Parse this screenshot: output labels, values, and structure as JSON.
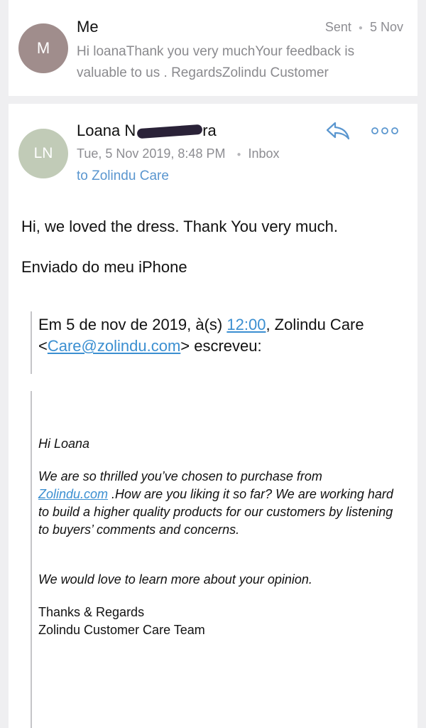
{
  "top_message": {
    "avatar_initial": "M",
    "sender": "Me",
    "status": "Sent",
    "date": "5 Nov",
    "preview": "Hi loanaThank you very muchYour feedback is valuable to us . RegardsZolindu Customer"
  },
  "main_message": {
    "avatar_initials": "LN",
    "sender_first": "Loana",
    "sender_last_visible_prefix": "N",
    "sender_last_visible_suffix": "ra",
    "datetime": "Tue, 5 Nov 2019, 8:48 PM",
    "folder": "Inbox",
    "to": "to Zolindu Care",
    "body_line_1": "Hi, we loved the dress. Thank You very much.",
    "body_line_2": "Enviado do meu iPhone",
    "quote_header": {
      "prefix": "Em 5 de nov de 2019, à(s) ",
      "time_link": "12:00",
      "middle": ", Zolindu Care <",
      "email_link": "Care@zolindu.com",
      "suffix": "> escreveu:"
    },
    "quoted": {
      "greeting": "Hi Loana",
      "para_before_link": "We are so thrilled you’ve chosen to purchase from ",
      "site_link": "Zolindu.com",
      "para_after_link": " .How are you liking it so far? We are working hard to build a higher quality products for our customers by listening to buyers’ comments and concerns.",
      "love_line": "We would love to learn more about your opinion.",
      "thanks": "Thanks & Regards",
      "team": "Zolindu Customer Care Team"
    }
  },
  "icons": {
    "reply": "reply-icon",
    "more": "more-options-icon"
  },
  "colors": {
    "background": "#efeff1",
    "link": "#3b8fd1",
    "to_link": "#5a96cf",
    "secondary_text": "#8d8d92",
    "avatar_m": "#a08d8c",
    "avatar_ln": "#c1cbb7"
  }
}
